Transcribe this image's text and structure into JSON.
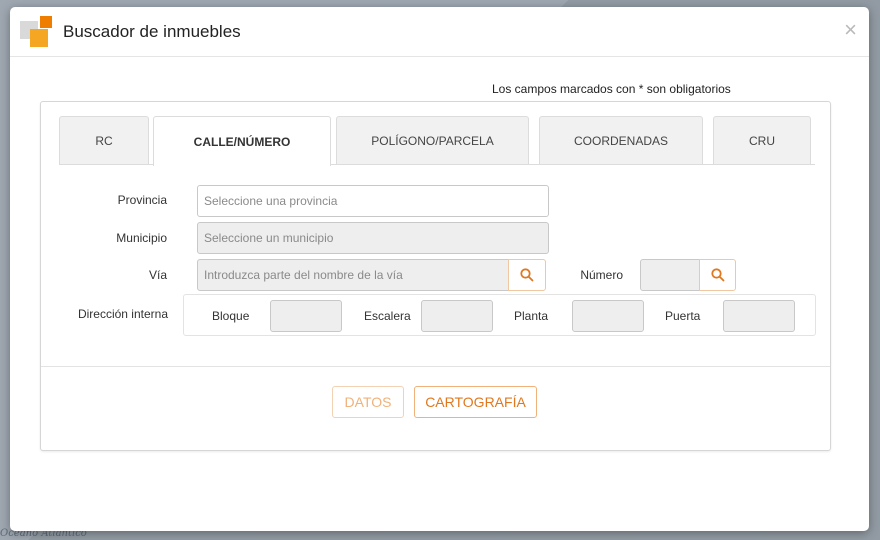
{
  "map": {
    "labels": [
      "Océano Atlántico"
    ]
  },
  "modal": {
    "title": "Buscador de inmuebles",
    "close_label": "×",
    "required_note": "Los campos marcados con * son obligatorios"
  },
  "tabs": [
    {
      "label": "RC",
      "active": false
    },
    {
      "label": "CALLE/NÚMERO",
      "active": true
    },
    {
      "label": "POLÍGONO/PARCELA",
      "active": false
    },
    {
      "label": "COORDENADAS",
      "active": false
    },
    {
      "label": "CRU",
      "active": false
    }
  ],
  "form": {
    "provincia": {
      "label": "Provincia",
      "placeholder": "Seleccione una provincia",
      "value": ""
    },
    "municipio": {
      "label": "Municipio",
      "placeholder": "Seleccione un municipio",
      "value": ""
    },
    "via": {
      "label": "Vía",
      "placeholder": "Introduzca parte del nombre de la vía",
      "value": ""
    },
    "numero": {
      "label": "Número",
      "value": ""
    },
    "direccion_interna": {
      "label": "Dirección interna",
      "bloque": "Bloque",
      "escalera": "Escalera",
      "planta": "Planta",
      "puerta": "Puerta"
    }
  },
  "buttons": {
    "datos": "DATOS",
    "cartografia": "CARTOGRAFÍA"
  },
  "colors": {
    "accent": "#e0781f",
    "accent_light": "#f0b27a"
  },
  "icons": {
    "search": "search-icon",
    "close": "close-icon",
    "logo": "catastro-logo-icon"
  }
}
